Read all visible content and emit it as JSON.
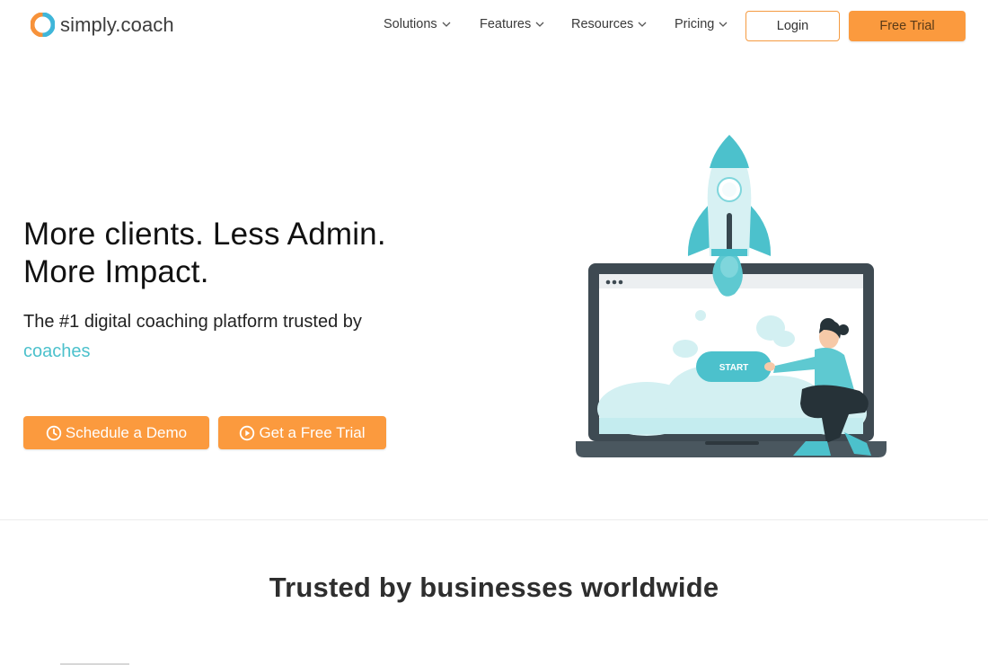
{
  "brand": {
    "name": "simply.coach",
    "colors": {
      "accent": "#fb9a3e",
      "teal": "#4cc1cc",
      "logo_blue": "#3fb6d9",
      "logo_orange": "#f7923a"
    }
  },
  "nav": {
    "items": [
      {
        "label": "Solutions",
        "icon": "chevron-down-icon"
      },
      {
        "label": "Features",
        "icon": "chevron-down-icon"
      },
      {
        "label": "Resources",
        "icon": "chevron-down-icon"
      },
      {
        "label": "Pricing",
        "icon": "chevron-down-icon"
      }
    ],
    "login_label": "Login",
    "free_trial_label": "Free Trial"
  },
  "hero": {
    "title_line1": "More clients. Less Admin.",
    "title_line2": "More Impact.",
    "subtitle": "The #1 digital coaching platform trusted by",
    "highlight": "coaches",
    "demo_button": {
      "label": "Schedule a Demo",
      "icon": "clock-icon"
    },
    "trial_button": {
      "label": "Get a Free Trial",
      "icon": "play-circle-icon"
    },
    "illustration": {
      "button_text": "START"
    }
  },
  "trusted": {
    "heading": "Trusted by businesses worldwide"
  }
}
